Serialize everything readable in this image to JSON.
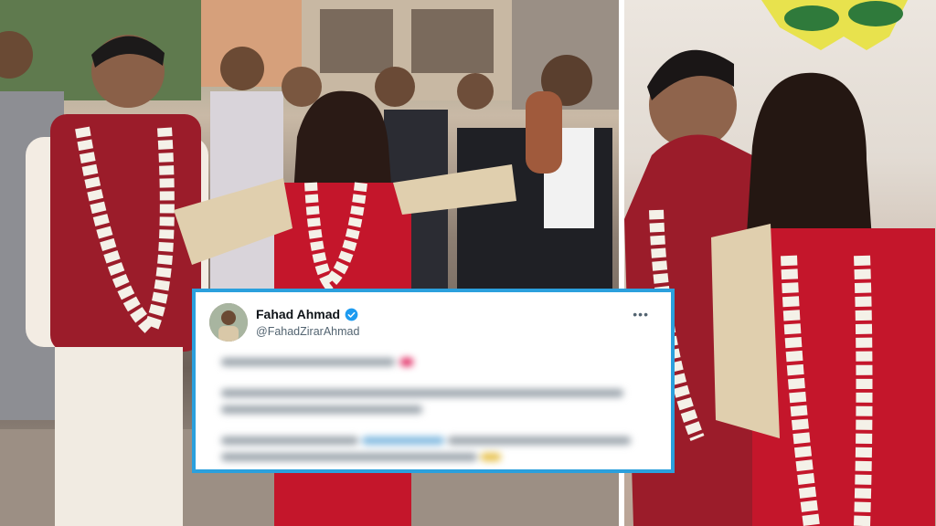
{
  "tweet": {
    "author_name": "Fahad Ahmad",
    "author_handle": "@FahadZirarAhmad",
    "verified": true,
    "more_icon": "ellipsis-icon",
    "body_blurred": true
  },
  "colors": {
    "card_border": "#2ba0dd",
    "verified_badge": "#1d9bf0",
    "kurta_red": "#9b1c2a",
    "saree_red": "#c4162b",
    "garland_white": "#f4f1e8"
  }
}
